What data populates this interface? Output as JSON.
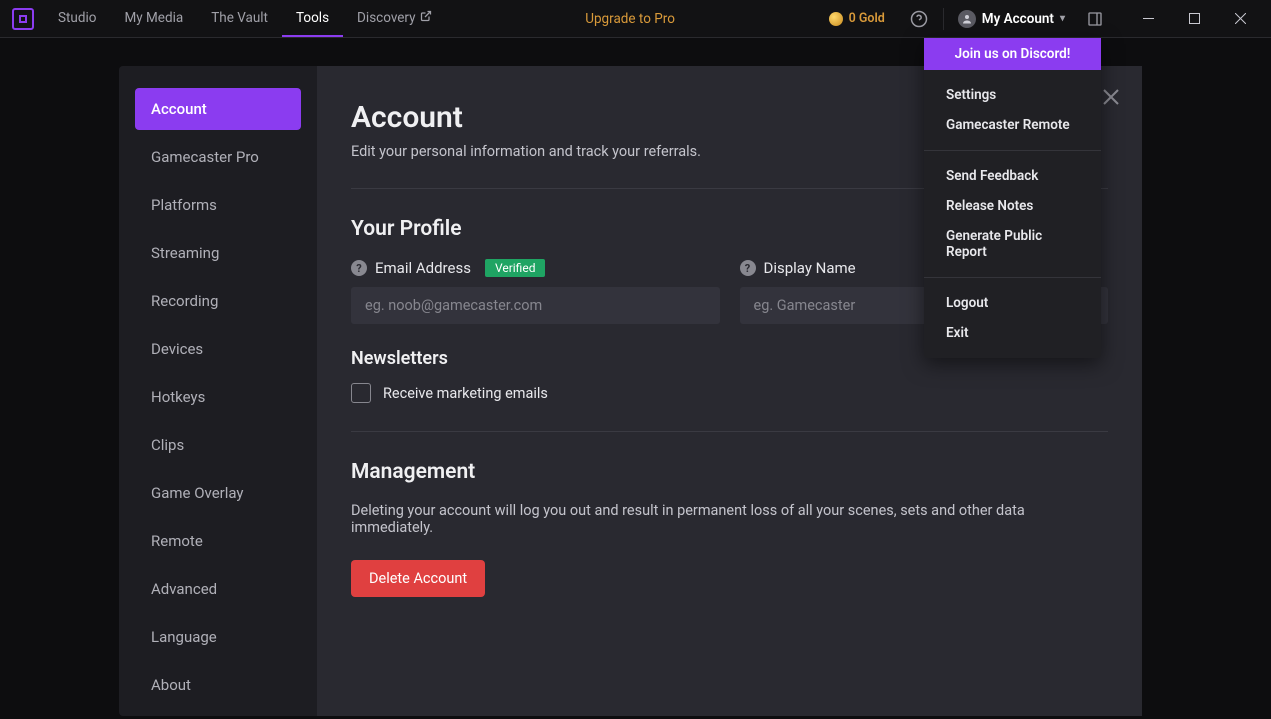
{
  "nav": {
    "tabs": [
      "Studio",
      "My Media",
      "The Vault",
      "Tools",
      "Discovery"
    ],
    "active_index": 3,
    "upgrade": "Upgrade to Pro",
    "gold": "0 Gold",
    "account_label": "My Account"
  },
  "dropdown": {
    "banner": "Join us on Discord!",
    "group1": [
      "Settings",
      "Gamecaster Remote"
    ],
    "group2": [
      "Send Feedback",
      "Release Notes",
      "Generate Public Report"
    ],
    "group3": [
      "Logout",
      "Exit"
    ]
  },
  "sidebar": {
    "items": [
      "Account",
      "Gamecaster Pro",
      "Platforms",
      "Streaming",
      "Recording",
      "Devices",
      "Hotkeys",
      "Clips",
      "Game Overlay",
      "Remote",
      "Advanced",
      "Language",
      "About"
    ],
    "active_index": 0
  },
  "page": {
    "title": "Account",
    "subtitle": "Edit your personal information and track your referrals.",
    "profile_heading": "Your Profile",
    "email_label": "Email Address",
    "verified_badge": "Verified",
    "email_placeholder": "eg. noob@gamecaster.com",
    "display_label": "Display Name",
    "display_placeholder": "eg. Gamecaster",
    "newsletters_heading": "Newsletters",
    "newsletter_checkbox": "Receive marketing emails",
    "management_heading": "Management",
    "management_text": "Deleting your account will log you out and result in permanent loss of all your scenes, sets and other data immediately.",
    "delete_button": "Delete Account"
  }
}
